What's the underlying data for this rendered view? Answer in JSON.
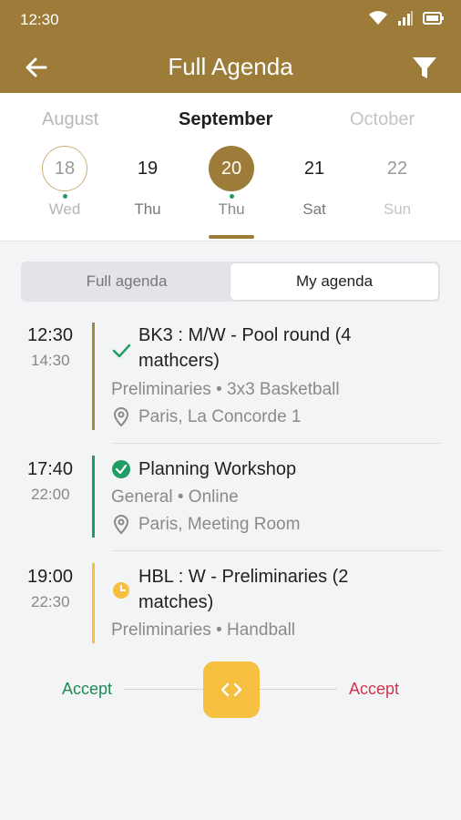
{
  "status_bar": {
    "time": "12:30",
    "icons": [
      "wifi-icon",
      "signal-icon",
      "battery-icon"
    ]
  },
  "app_bar": {
    "title": "Full Agenda",
    "back_icon": "arrow-left-icon",
    "filter_icon": "filter-icon"
  },
  "calendar": {
    "months": {
      "prev": "August",
      "current": "September",
      "next": "October"
    },
    "days": [
      {
        "number": "18",
        "weekday": "Wed",
        "has_event": true
      },
      {
        "number": "19",
        "weekday": "Thu",
        "has_event": false
      },
      {
        "number": "20",
        "weekday": "Thu",
        "has_event": true,
        "selected": true
      },
      {
        "number": "21",
        "weekday": "Sat",
        "has_event": false
      },
      {
        "number": "22",
        "weekday": "Sun",
        "has_event": false
      }
    ]
  },
  "tabs": {
    "left": "Full agenda",
    "right": "My agenda",
    "active": "My agenda"
  },
  "events": [
    {
      "start": "12:30",
      "end": "14:30",
      "title_line1": "BK3 : M/W - Pool round (4",
      "title_line2": "mathcers)",
      "meta": "Preliminaries • 3x3 Basketball",
      "location": "Paris, La Concorde 1",
      "status": "checkmark",
      "accent": "#a6873f"
    },
    {
      "start": "17:40",
      "end": "22:00",
      "title_line1": "Planning Workshop",
      "meta": "General • Online",
      "location": "Paris, Meeting Room",
      "status": "check-circle",
      "accent": "#1f9d63"
    },
    {
      "start": "19:00",
      "end": "22:30",
      "title_line1": "HBL : W - Preliminaries (2",
      "title_line2": "matches)",
      "meta": "Preliminaries • Handball",
      "status": "clock",
      "accent": "#f6bf40"
    }
  ],
  "swipe": {
    "left_label": "Accept",
    "right_label": "Accept",
    "handle_label": "< >",
    "left_color": "#1f8a56",
    "right_color": "#d0364a"
  },
  "colors": {
    "brand": "#9c7c38",
    "background": "#f3f4f6"
  }
}
